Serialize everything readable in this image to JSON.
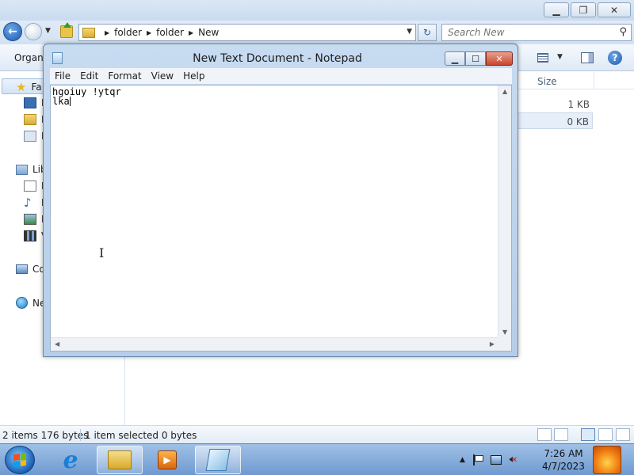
{
  "explorer": {
    "breadcrumb": [
      "folder",
      "folder",
      "New"
    ],
    "search_placeholder": "Search New",
    "organize_label": "Organi",
    "nav_pane": {
      "favorites_label": "Fa",
      "libraries_label": "Lib",
      "computer_label": "Co",
      "network_label": "Ne",
      "favorites_sub": [
        "D",
        "D",
        "R"
      ],
      "libraries_sub": [
        "D",
        "M",
        "P",
        "V"
      ]
    },
    "columns": {
      "size": "Size"
    },
    "files": [
      {
        "size": "1 KB",
        "selected": false
      },
      {
        "size": "0 KB",
        "selected": true
      }
    ],
    "status": {
      "items": "2 items  176 bytes",
      "selection": "1 item selected  0 bytes"
    }
  },
  "notepad": {
    "title": "New Text Document - Notepad",
    "menu": [
      "File",
      "Edit",
      "Format",
      "View",
      "Help"
    ],
    "content_lines": [
      "hgoiuy !ytqr",
      "lka"
    ]
  },
  "taskbar": {
    "clock_time": "7:26 AM",
    "clock_date": "4/7/2023",
    "pinned": [
      "internet-explorer",
      "windows-explorer",
      "media-player",
      "notepad"
    ]
  }
}
